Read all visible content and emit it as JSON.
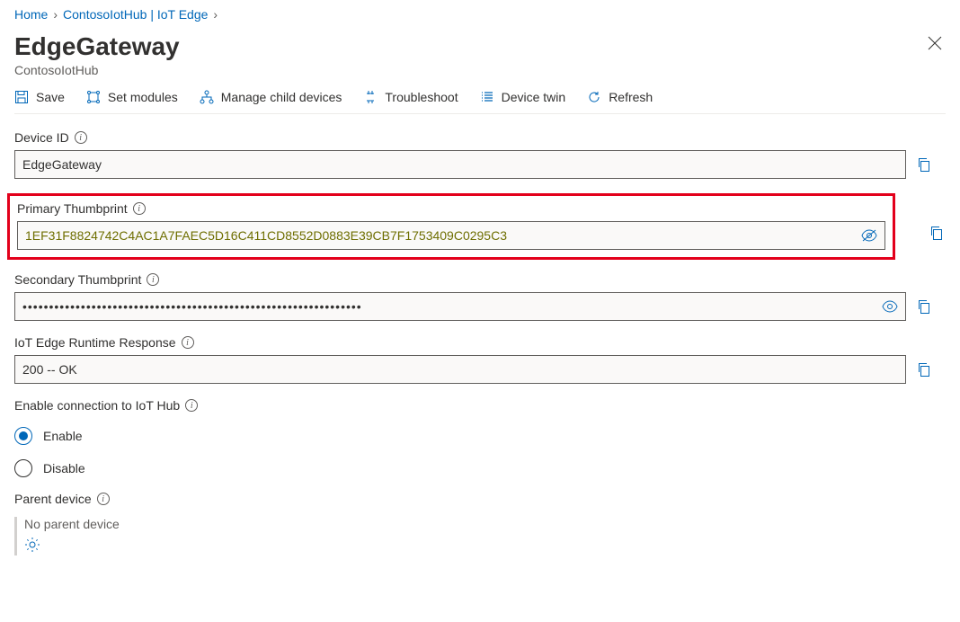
{
  "breadcrumb": {
    "home": "Home",
    "hub": "ContosoIotHub | IoT Edge"
  },
  "header": {
    "title": "EdgeGateway",
    "subtitle": "ContosoIotHub"
  },
  "toolbar": {
    "save": "Save",
    "set_modules": "Set modules",
    "manage_children": "Manage child devices",
    "troubleshoot": "Troubleshoot",
    "device_twin": "Device twin",
    "refresh": "Refresh"
  },
  "fields": {
    "device_id_label": "Device ID",
    "device_id_value": "EdgeGateway",
    "primary_thumb_label": "Primary Thumbprint",
    "primary_thumb_value": "1EF31F8824742C4AC1A7FAEC5D16C411CD8552D0883E39CB7F1753409C0295C3",
    "secondary_thumb_label": "Secondary Thumbprint",
    "secondary_thumb_value": "••••••••••••••••••••••••••••••••••••••••••••••••••••••••••••••••",
    "runtime_label": "IoT Edge Runtime Response",
    "runtime_value": "200 -- OK",
    "enable_conn_label": "Enable connection to IoT Hub",
    "enable_option": "Enable",
    "disable_option": "Disable",
    "parent_label": "Parent device",
    "parent_value": "No parent device"
  },
  "colors": {
    "accent": "#0067b8",
    "highlight_border": "#e3001b"
  }
}
